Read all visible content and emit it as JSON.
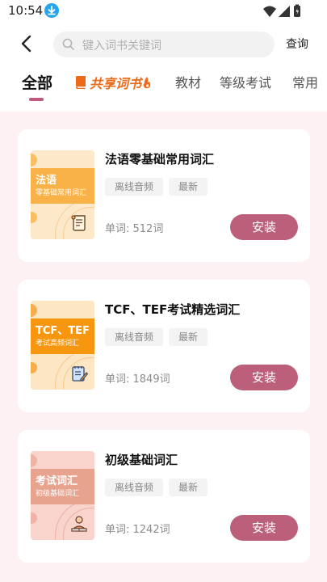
{
  "status_bar": {
    "time": "10:54",
    "download_icon": "download-icon",
    "wifi_icon": "wifi-icon",
    "signal_icon": "signal-icon",
    "battery_icon": "battery-icon"
  },
  "header": {
    "back_icon": "back-arrow-icon",
    "search_icon": "search-icon",
    "search_placeholder": "键入词书关键词",
    "query_label": "查询"
  },
  "tabs": {
    "all": "全部",
    "featured": "共享词书",
    "textbook": "教材",
    "grade_exam": "等级考试",
    "common": "常用"
  },
  "colors": {
    "accent": "#bb5f7a",
    "tab_underline": "#c05a82",
    "featured_orange": "#ec6b1a",
    "background": "#fdf1f4"
  },
  "books": [
    {
      "cover_title": "法语",
      "cover_subtitle": "零基础常用词汇",
      "title": "法语零基础常用词汇",
      "tag_offline": "离线音频",
      "tag_latest": "最新",
      "word_count": "单词: 512词",
      "install_label": "安装",
      "cover_icon": "scroll-icon"
    },
    {
      "cover_title": "TCF、TEF",
      "cover_subtitle": "考试高频词汇",
      "title": "TCF、TEF考试精选词汇",
      "tag_offline": "离线音频",
      "tag_latest": "最新",
      "word_count": "单词: 1849词",
      "install_label": "安装",
      "cover_icon": "notepad-icon"
    },
    {
      "cover_title": "考试词汇",
      "cover_subtitle": "初级基础词汇",
      "title": "初级基础词汇",
      "tag_offline": "离线音频",
      "tag_latest": "最新",
      "word_count": "单词: 1242词",
      "install_label": "安装",
      "cover_icon": "reader-icon"
    }
  ]
}
